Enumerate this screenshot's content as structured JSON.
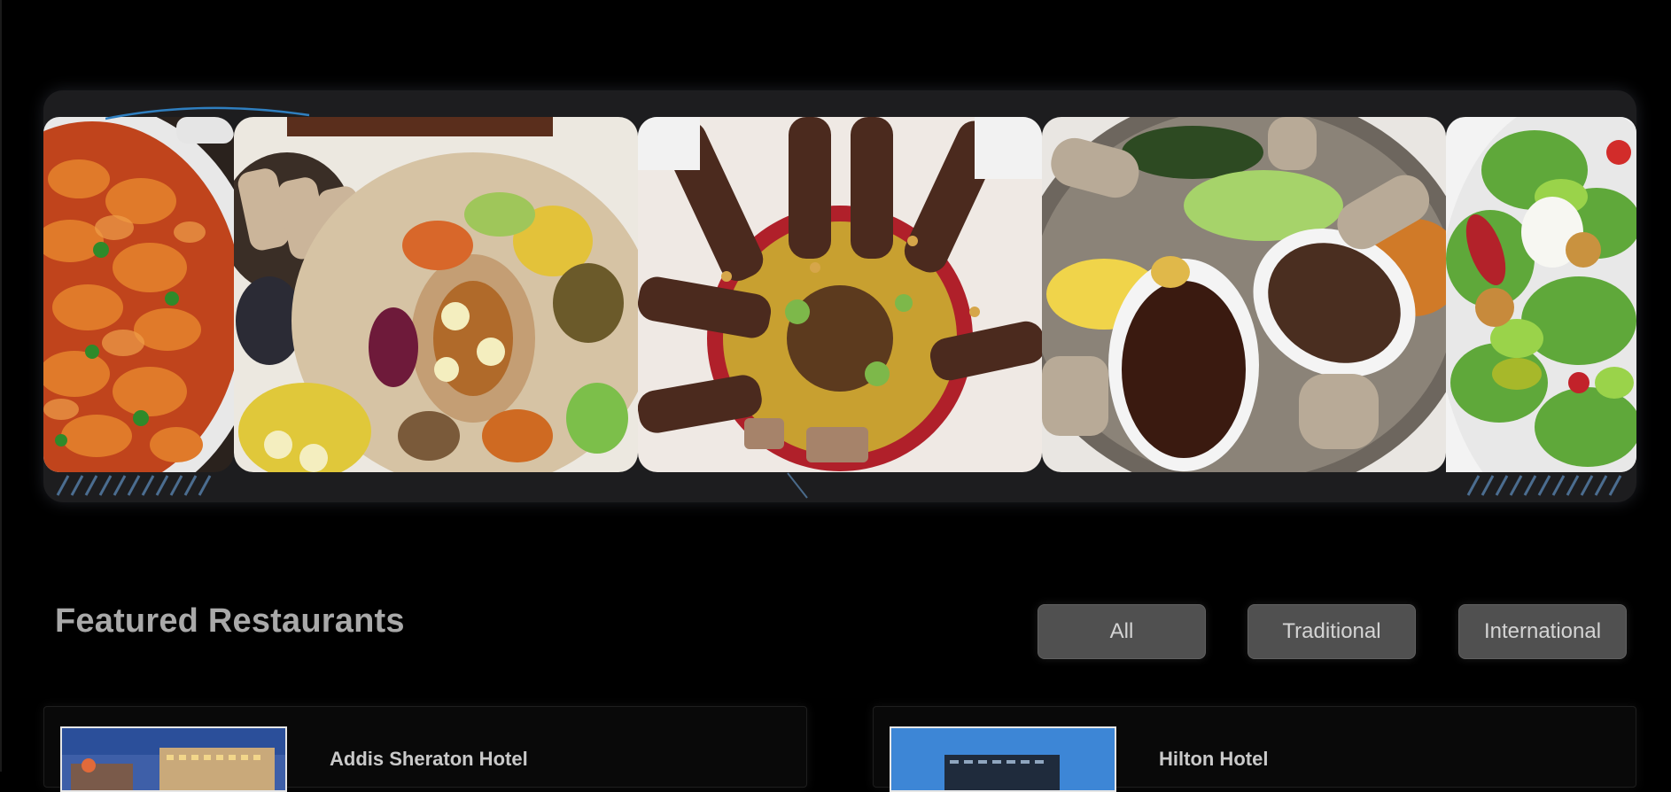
{
  "carousel": {
    "slides": [
      {
        "icon": "potato-stew-photo"
      },
      {
        "icon": "ethiopian-platter-photo"
      },
      {
        "icon": "henna-hands-sharing-photo"
      },
      {
        "icon": "injera-stew-platter-photo"
      },
      {
        "icon": "green-salad-photo"
      }
    ]
  },
  "featured": {
    "title": "Featured Restaurants",
    "filters": [
      "All",
      "Traditional",
      "International"
    ]
  },
  "restaurants": [
    {
      "name": "Addis Sheraton Hotel"
    },
    {
      "name": "Hilton Hotel"
    }
  ],
  "colors": {
    "background": "#000000",
    "panel": "#1d1d1f",
    "button": "#505050",
    "accent": "#2f7fc0"
  }
}
